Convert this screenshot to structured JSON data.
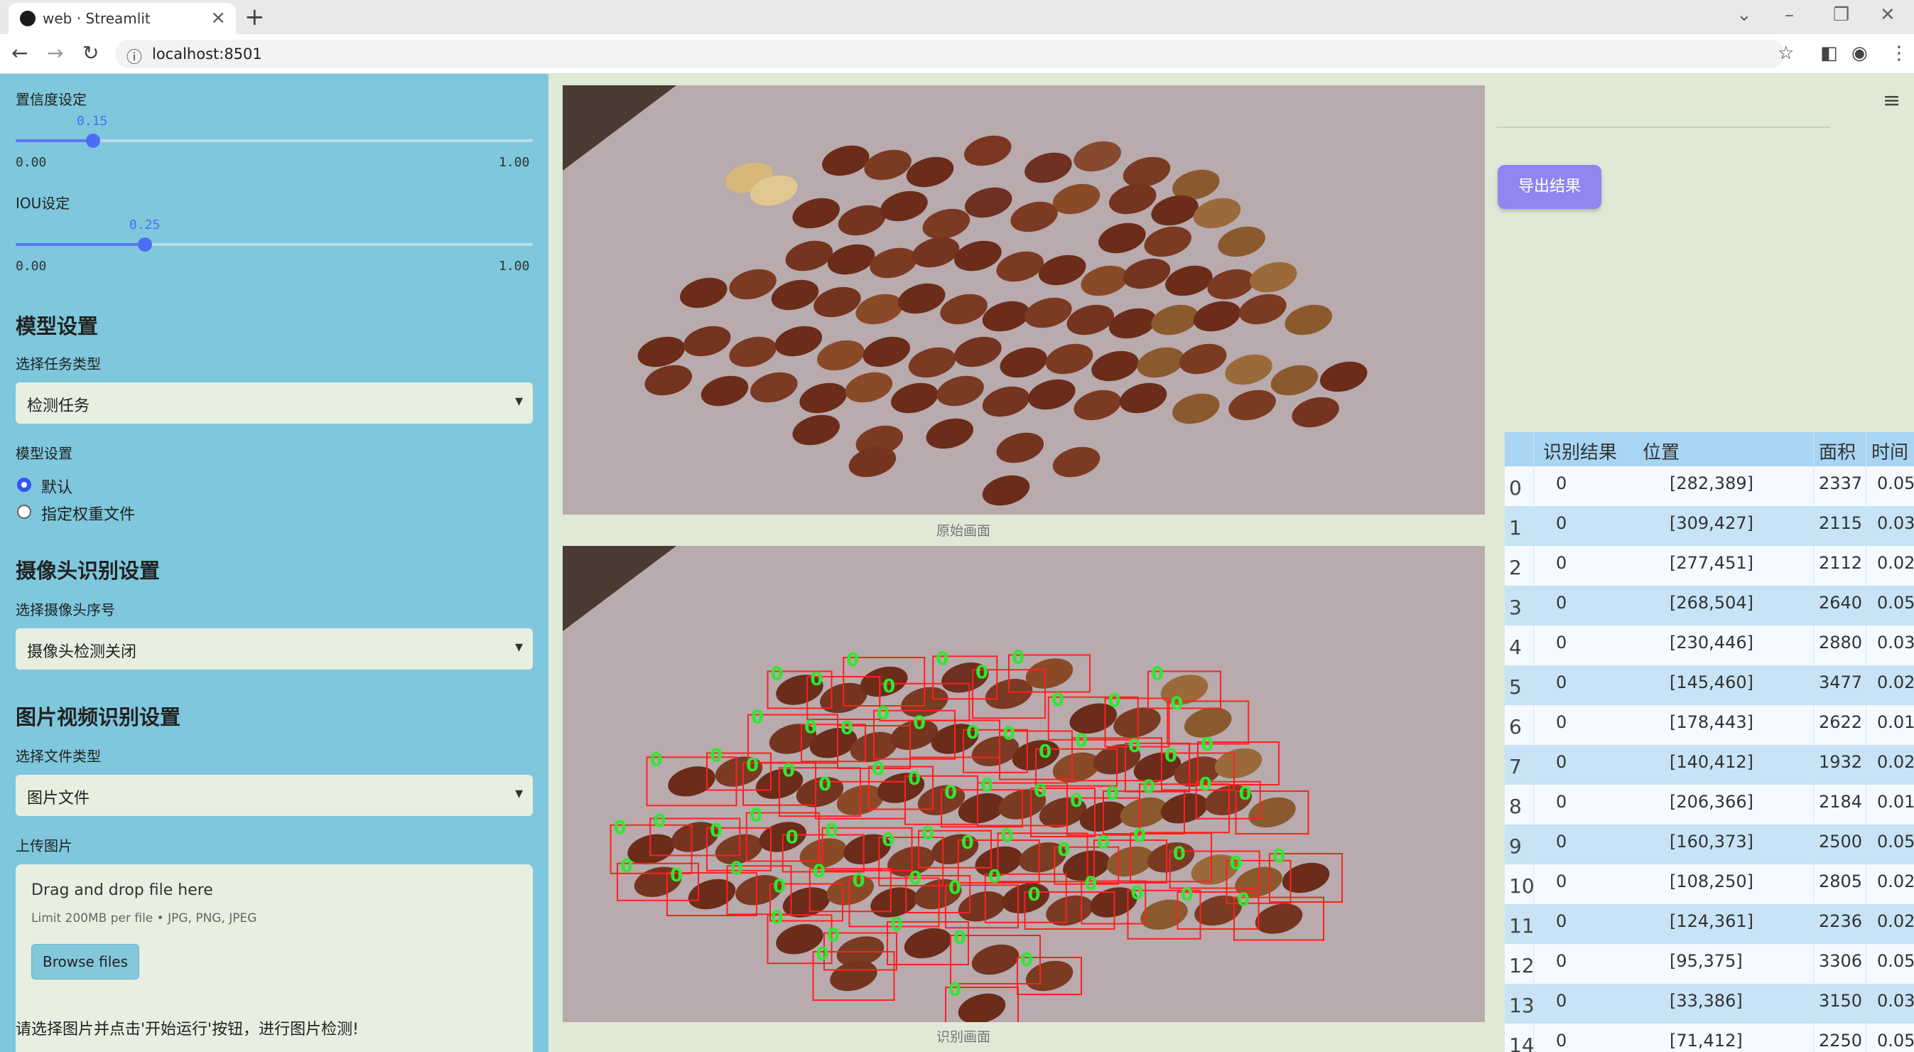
{
  "browser": {
    "tab_title": "web · Streamlit",
    "url": "localhost:8501"
  },
  "sidebar": {
    "confidence": {
      "label": "置信度设定",
      "value": "0.15",
      "value_num": 0.15,
      "min": "0.00",
      "max": "1.00"
    },
    "iou": {
      "label": "IOU设定",
      "value": "0.25",
      "value_num": 0.25,
      "min": "0.00",
      "max": "1.00"
    },
    "model_section": {
      "title": "模型设置",
      "task_label": "选择任务类型",
      "task_value": "检测任务",
      "model_label": "模型设置",
      "options": [
        "默认",
        "指定权重文件"
      ],
      "selected_option": "默认"
    },
    "camera_section": {
      "title": "摄像头识别设置",
      "select_label": "选择摄像头序号",
      "select_value": "摄像头检测关闭"
    },
    "media_section": {
      "title": "图片视频识别设置",
      "type_label": "选择文件类型",
      "type_value": "图片文件",
      "upload_label": "上传图片",
      "drop_text": "Drag and drop file here",
      "limit_text": "Limit 200MB per file • JPG, PNG, JPEG",
      "browse_label": "Browse files"
    },
    "hint": "请选择图片并点击'开始运行'按钮，进行图片检测!"
  },
  "main": {
    "original_caption": "原始画面",
    "detect_caption": "识别画面",
    "export_label": "导出结果",
    "detection_label": "0"
  },
  "table": {
    "headers": [
      "识别结果",
      "位置",
      "面积",
      "时间"
    ],
    "rows": [
      {
        "index": "0",
        "result": "0",
        "position": "[282,389]",
        "area": "2337",
        "time": "0.05"
      },
      {
        "index": "1",
        "result": "0",
        "position": "[309,427]",
        "area": "2115",
        "time": "0.03"
      },
      {
        "index": "2",
        "result": "0",
        "position": "[277,451]",
        "area": "2112",
        "time": "0.02"
      },
      {
        "index": "3",
        "result": "0",
        "position": "[268,504]",
        "area": "2640",
        "time": "0.05"
      },
      {
        "index": "4",
        "result": "0",
        "position": "[230,446]",
        "area": "2880",
        "time": "0.03"
      },
      {
        "index": "5",
        "result": "0",
        "position": "[145,460]",
        "area": "3477",
        "time": "0.02"
      },
      {
        "index": "6",
        "result": "0",
        "position": "[178,443]",
        "area": "2622",
        "time": "0.01"
      },
      {
        "index": "7",
        "result": "0",
        "position": "[140,412]",
        "area": "1932",
        "time": "0.02"
      },
      {
        "index": "8",
        "result": "0",
        "position": "[206,366]",
        "area": "2184",
        "time": "0.01"
      },
      {
        "index": "9",
        "result": "0",
        "position": "[160,373]",
        "area": "2500",
        "time": "0.05"
      },
      {
        "index": "10",
        "result": "0",
        "position": "[108,250]",
        "area": "2805",
        "time": "0.02"
      },
      {
        "index": "11",
        "result": "0",
        "position": "[124,361]",
        "area": "2236",
        "time": "0.02"
      },
      {
        "index": "12",
        "result": "0",
        "position": "[95,375]",
        "area": "3306",
        "time": "0.05"
      },
      {
        "index": "13",
        "result": "0",
        "position": "[33,386]",
        "area": "3150",
        "time": "0.03"
      },
      {
        "index": "14",
        "result": "0",
        "position": "[71,412]",
        "area": "2250",
        "time": "0.05"
      }
    ]
  },
  "colors": {
    "sidebar_bg": "#7ec7dc",
    "main_bg": "#dfe9d6",
    "slider_accent": "#4d6ef2",
    "export_button": "#8f86f0",
    "box_red": "#ff2020",
    "label_green": "#2ee82e",
    "table_header": "#a8d5f3",
    "table_alt_row": "#c7e3f5"
  },
  "icons": [
    "streamlit-favicon",
    "close-icon",
    "new-tab-icon",
    "minimize-icon",
    "restore-icon",
    "window-close-icon",
    "back-icon",
    "forward-icon",
    "reload-icon",
    "info-icon",
    "star-icon",
    "sidebar-icon",
    "profile-icon",
    "kebab-menu-icon",
    "hamburger-icon",
    "chevron-down-icon"
  ]
}
